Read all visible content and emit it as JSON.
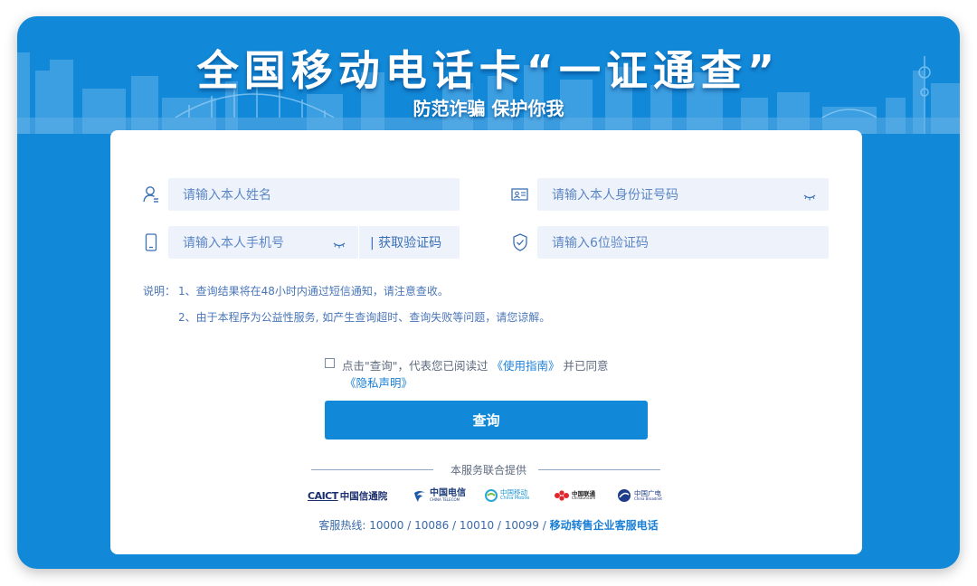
{
  "hero": {
    "title": "全国移动电话卡“一证通查”",
    "subtitle": "防范诈骗 保护你我"
  },
  "form": {
    "name_placeholder": "请输入本人姓名",
    "id_placeholder": "请输入本人身份证号码",
    "phone_placeholder": "请输入本人手机号",
    "get_code_label": "| 获取验证码",
    "code_placeholder": "请输入6位验证码"
  },
  "notes": {
    "prefix": "说明：",
    "line1": "1、查询结果将在48小时内通过短信通知，请注意查收。",
    "line2": "2、由于本程序为公益性服务, 如产生查询超时、查询失败等问题，请您谅解。"
  },
  "agreement": {
    "text": "点击\"查询\"，代表您已阅读过",
    "guide_link": "《使用指南》",
    "suffix": "并已同意",
    "privacy_link": "《隐私声明》"
  },
  "submit_label": "查询",
  "partners": {
    "label": "本服务联合提供",
    "caict_abbr": "CAICT",
    "caict_name": "中国信通院",
    "telecom_name": "中国电信",
    "telecom_en": "CHINA TELECOM",
    "mobile_name": "中国移动",
    "mobile_en": "China Mobile",
    "unicom_name": "中国联通",
    "unicom_en": "Chinaunicom",
    "broadnet_name": "中国广电",
    "broadnet_en": "China Broadnet"
  },
  "hotline": {
    "text": "客服热线: 10000 / 10086 / 10010 / 10099 /",
    "link": "移动转售企业客服电话"
  },
  "colors": {
    "brand_blue": "#1289d8",
    "field_bg": "#eef3fb",
    "link_blue": "#1a7fd6"
  },
  "icons": [
    "user-icon",
    "id-card-icon",
    "phone-icon",
    "shield-check-icon",
    "eye-closed-icon",
    "checkbox-icon"
  ]
}
